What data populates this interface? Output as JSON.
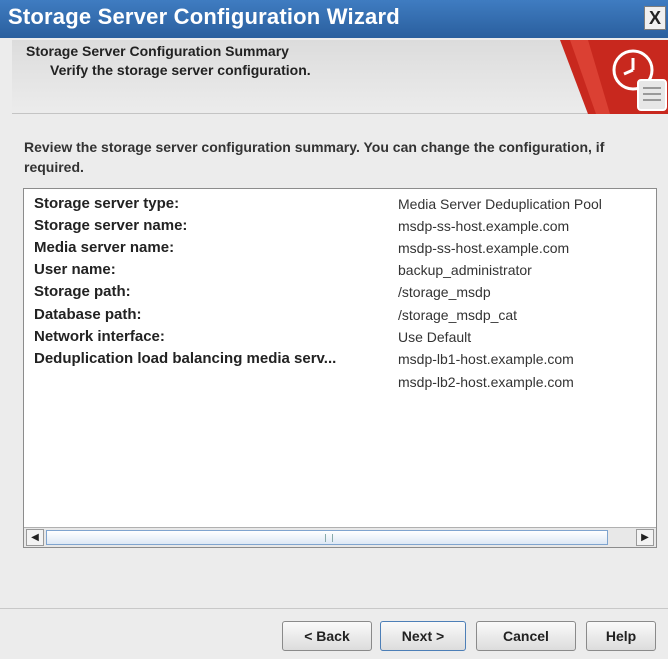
{
  "window": {
    "title": "Storage Server Configuration Wizard",
    "close_label": "X"
  },
  "header": {
    "title": "Storage Server Configuration Summary",
    "subtitle": "Verify the storage server configuration."
  },
  "intro_text": "Review the storage server configuration summary. You can change the configuration, if required.",
  "summary": {
    "rows": [
      {
        "label": "Storage server type:",
        "value": "Media Server Deduplication Pool"
      },
      {
        "label": "Storage server name:",
        "value": "msdp-ss-host.example.com"
      },
      {
        "label": "Media server name:",
        "value": "msdp-ss-host.example.com"
      },
      {
        "label": "User name:",
        "value": "backup_administrator"
      },
      {
        "label": "Storage path:",
        "value": "/storage_msdp"
      },
      {
        "label": "Database path:",
        "value": "/storage_msdp_cat"
      },
      {
        "label": "Network interface:",
        "value": "Use Default"
      },
      {
        "label": "Deduplication load balancing media serv...",
        "value": "msdp-lb1-host.example.com"
      },
      {
        "label": "",
        "value": "msdp-lb2-host.example.com"
      }
    ]
  },
  "buttons": {
    "back": "< Back",
    "next": "Next >",
    "cancel": "Cancel",
    "help": "Help"
  },
  "colors": {
    "titlebar": "#2f6db3",
    "accent_red": "#c8281e"
  },
  "icons": {
    "header_graphic": "clock-scroll-icon",
    "scroll_left": "arrow-left-icon",
    "scroll_right": "arrow-right-icon"
  }
}
